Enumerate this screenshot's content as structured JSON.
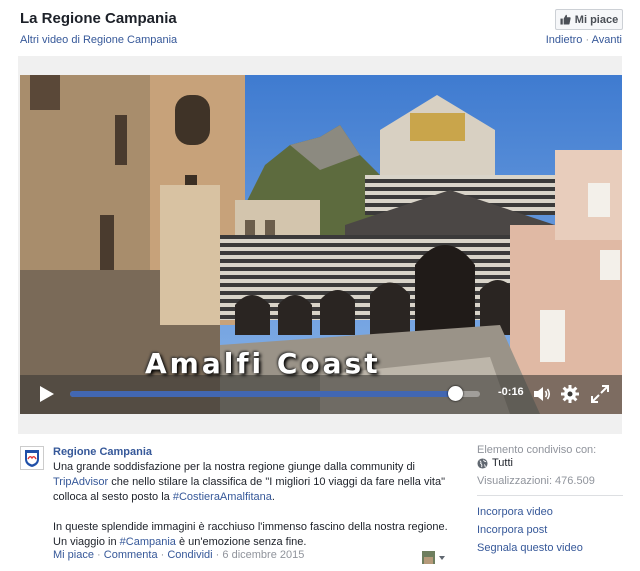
{
  "header": {
    "title": "La Regione Campania",
    "more_videos": "Altri video di Regione Campania",
    "like_button": "Mi piace",
    "prev": "Indietro",
    "next": "Avanti"
  },
  "video": {
    "overlay_title": "Amalfi Coast",
    "time_remaining": "-0:16",
    "progress": 0.94,
    "icons": [
      "play-icon",
      "volume-icon",
      "settings-icon",
      "fullscreen-icon"
    ]
  },
  "post": {
    "author": "Regione Campania",
    "text_1": "Una grande soddisfazione per la nostra regione giunge dalla community di ",
    "link_tripadvisor": "TripAdvisor",
    "text_2": " che nello stilare la classifica de \"I migliori 10 viaggi da fare nella vita\" colloca al sesto posto la ",
    "link_hashtag_1": "#CostieraAmalfitana",
    "text_3": ".",
    "text_4": "In queste splendide immagini è racchiuso l'immenso fascino della nostra regione. Un viaggio in ",
    "link_hashtag_2": "#Campania",
    "text_5": " è un'emozione senza fine.",
    "action_like": "Mi piace",
    "action_comment": "Commenta",
    "action_share": "Condividi",
    "date": "6 dicembre 2015"
  },
  "sidebar": {
    "shared_with_label": "Elemento condiviso con:",
    "privacy": "Tutti",
    "views": "Visualizzazioni: 476.509",
    "links": [
      "Incorpora video",
      "Incorpora post",
      "Segnala questo video"
    ]
  },
  "colors": {
    "link": "#365899",
    "progress_fill": "#4267b2",
    "sky": "#5a8fd6"
  }
}
